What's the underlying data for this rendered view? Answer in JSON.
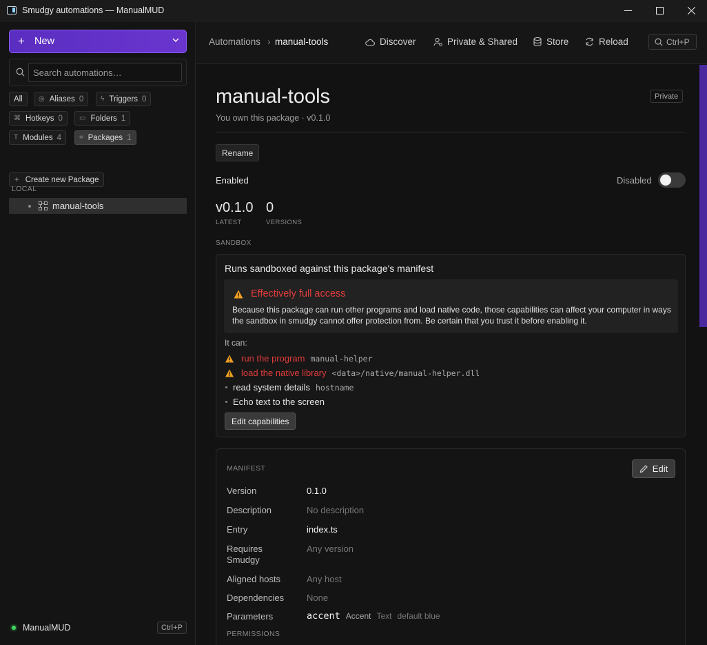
{
  "window": {
    "title": "Smudgy automations — ManualMUD",
    "controls": [
      "—",
      "☐",
      "✕"
    ]
  },
  "sidebar": {
    "new_label": "New",
    "search_placeholder": "Search automations…",
    "filters": [
      {
        "label": "All",
        "count": ""
      },
      {
        "label": "Aliases",
        "count": "0"
      },
      {
        "label": "Triggers",
        "count": "0"
      },
      {
        "label": "Hotkeys",
        "count": "0"
      },
      {
        "label": "Folders",
        "count": "1"
      },
      {
        "label": "Modules",
        "count": "4"
      },
      {
        "label": "Packages",
        "count": "1"
      }
    ],
    "create_package": "Create new Package",
    "section": "LOCAL",
    "tree_item": "manual-tools",
    "status": {
      "label": "ManualMUD",
      "shortcut": "Ctrl+P",
      "color": "#3ed65e"
    }
  },
  "topnav": {
    "breadcrumb_root": "Automations",
    "breadcrumb_sep": "›",
    "breadcrumb_current": "manual-tools",
    "links": [
      "Discover",
      "Private & Shared",
      "Store",
      "Reload"
    ],
    "command_shortcut": "Ctrl+P"
  },
  "package": {
    "title": "manual-tools",
    "subtitle": "You own this package · v0.1.0",
    "visibility": "Private",
    "rename": "Rename",
    "enabled_label": "Enabled",
    "disabled_label": "Disabled",
    "stats": [
      {
        "value": "v0.1.0",
        "label": "LATEST"
      },
      {
        "value": "0",
        "label": "VERSIONS"
      }
    ],
    "sandbox_section": "SANDBOX"
  },
  "sandbox": {
    "title": "Runs sandboxed against this package's manifest",
    "warning_title": "Effectively full access",
    "warning_body": "Because this package can run other programs and load native code, those capabilities can affect your computer in ways the sandbox in smudgy cannot offer protection from. Be certain that you trust it before enabling it.",
    "it_can": "It can:",
    "capabilities": [
      {
        "text": "run the program",
        "code": "manual-helper",
        "danger": true
      },
      {
        "text": "load the native library",
        "code": "<data>/native/manual-helper.dll",
        "danger": true
      },
      {
        "text": "read system details",
        "code": "hostname",
        "danger": false
      },
      {
        "text": "Echo text to the screen",
        "code": "",
        "danger": false
      }
    ],
    "edit_capabilities": "Edit capabilities",
    "danger_color": "#e23b3b",
    "warning_icon_color": "#f0a020"
  },
  "manifest": {
    "section": "MANIFEST",
    "edit": "Edit",
    "rows": [
      {
        "key": "Version",
        "value": "0.1.0"
      },
      {
        "key": "Description",
        "value": "No description"
      },
      {
        "key": "Entry",
        "value": "index.ts"
      },
      {
        "key": "Requires Smudgy",
        "value": "Any version"
      },
      {
        "key": "Aligned hosts",
        "value": "Any host"
      },
      {
        "key": "Dependencies",
        "value": "None"
      },
      {
        "key": "Parameters",
        "value": ""
      }
    ],
    "parameter": {
      "name": "accent",
      "label": "Accent",
      "type": "Text",
      "default": "default blue"
    },
    "permissions": "PERMISSIONS"
  },
  "accent": "#5a2ec0"
}
